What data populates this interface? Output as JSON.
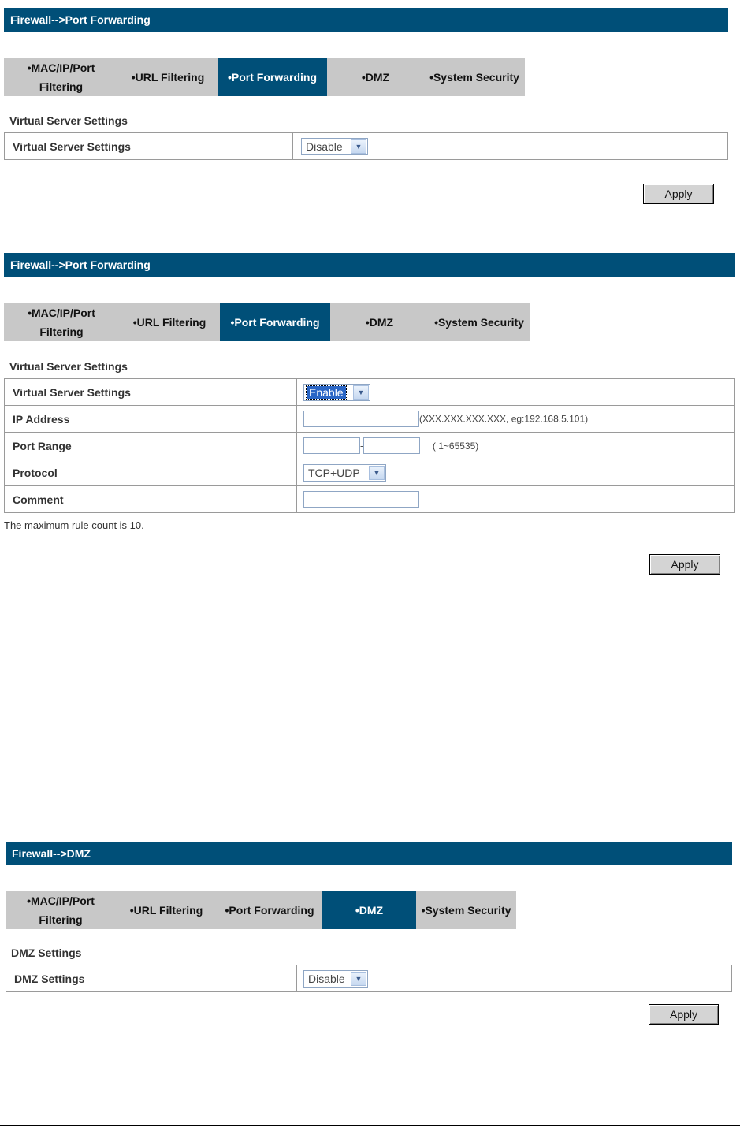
{
  "panel1": {
    "title": "Firewall-->Port Forwarding",
    "tabs": [
      "•MAC/IP/Port Filtering",
      "•URL Filtering",
      "•Port Forwarding",
      "•DMZ",
      "•System Security"
    ],
    "active_tab": 2,
    "section_title": "Virtual Server Settings",
    "rows": [
      {
        "label": "Virtual Server Settings",
        "control": "select",
        "value": "Disable"
      }
    ],
    "apply_label": "Apply"
  },
  "panel2": {
    "title": "Firewall-->Port Forwarding",
    "tabs": [
      "•MAC/IP/Port Filtering",
      "•URL Filtering",
      "•Port Forwarding",
      "•DMZ",
      "•System Security"
    ],
    "active_tab": 2,
    "section_title": "Virtual Server Settings",
    "rows": [
      {
        "label": "Virtual Server Settings",
        "control": "select",
        "value": "Enable"
      },
      {
        "label": "IP Address",
        "control": "text",
        "value": "",
        "hint": "(XXX.XXX.XXX.XXX, eg:192.168.5.101)"
      },
      {
        "label": "Port Range",
        "control": "range",
        "from": "",
        "to": "",
        "separator": "-",
        "hint": "( 1~65535)"
      },
      {
        "label": "Protocol",
        "control": "select",
        "value": "TCP+UDP"
      },
      {
        "label": "Comment",
        "control": "text",
        "value": ""
      }
    ],
    "note": "The maximum rule count is 10.",
    "apply_label": "Apply"
  },
  "panel3": {
    "title": "Firewall-->DMZ",
    "tabs": [
      "•MAC/IP/Port Filtering",
      "•URL Filtering",
      "•Port Forwarding",
      "•DMZ",
      "•System Security"
    ],
    "active_tab": 3,
    "section_title": "DMZ Settings",
    "rows": [
      {
        "label": "DMZ Settings",
        "control": "select",
        "value": "Disable"
      }
    ],
    "apply_label": "Apply"
  },
  "icons": {
    "dropdown": "chevron-down-icon"
  },
  "colors": {
    "accent": "#004f78",
    "tabbar": "#c8c8c8"
  }
}
